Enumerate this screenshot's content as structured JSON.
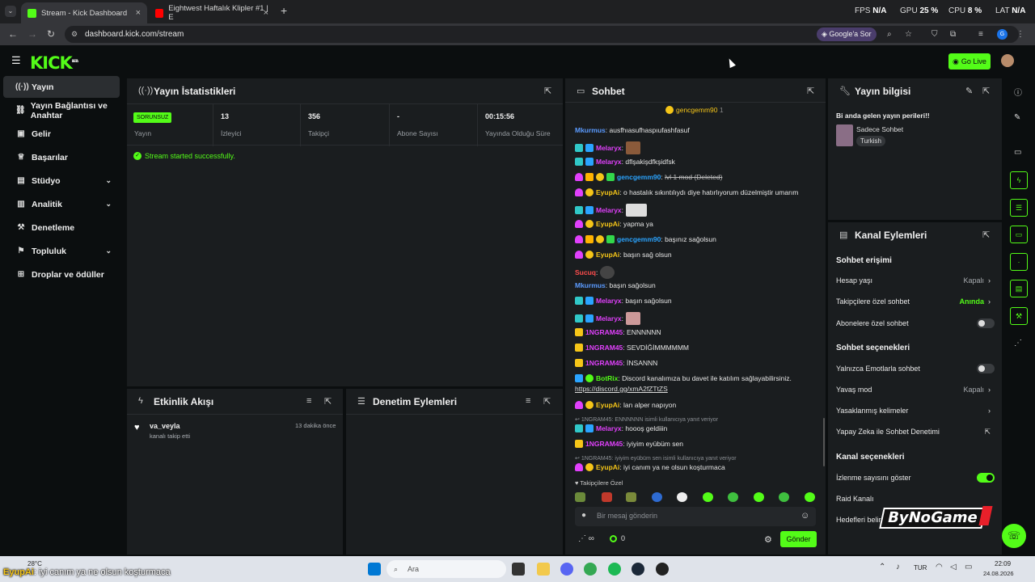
{
  "browser": {
    "tabs": [
      {
        "label": "Stream - Kick Dashboard",
        "active": true
      },
      {
        "label": "Eightwest Haftalık Klipler #1 | E",
        "active": false
      }
    ],
    "url": "dashboard.kick.com/stream",
    "google_sor": "Google'a Sor",
    "perf": {
      "fps_label": "FPS",
      "fps": "N/A",
      "gpu_label": "GPU",
      "gpu": "25 %",
      "cpu_label": "CPU",
      "cpu": "8 %",
      "lat_label": "LAT",
      "lat": "N/A"
    },
    "profile_initial": "G"
  },
  "header": {
    "logo": "KICK",
    "logo_beta": "BETA",
    "go_live": "Go Live"
  },
  "sidebar": {
    "items": [
      {
        "label": "Yayın",
        "icon": "broadcast-icon",
        "active": true,
        "chevron": false
      },
      {
        "label": "Yayın Bağlantısı ve Anahtar",
        "icon": "link-icon",
        "active": false,
        "chevron": false
      },
      {
        "label": "Gelir",
        "icon": "money-icon",
        "active": false,
        "chevron": false
      },
      {
        "label": "Başarılar",
        "icon": "trophy-icon",
        "active": false,
        "chevron": false
      },
      {
        "label": "Stüdyo",
        "icon": "studio-icon",
        "active": false,
        "chevron": true
      },
      {
        "label": "Analitik",
        "icon": "chart-icon",
        "active": false,
        "chevron": true
      },
      {
        "label": "Denetleme",
        "icon": "hammer-icon",
        "active": false,
        "chevron": false
      },
      {
        "label": "Topluluk",
        "icon": "community-icon",
        "active": false,
        "chevron": true
      },
      {
        "label": "Droplar ve ödüller",
        "icon": "gift-icon",
        "active": false,
        "chevron": false
      }
    ]
  },
  "stats_panel": {
    "title": "Yayın İstatistikleri",
    "status_badge": "SORUNSUZ",
    "stats": [
      {
        "value": "",
        "label": "Yayın"
      },
      {
        "value": "13",
        "label": "İzleyici"
      },
      {
        "value": "356",
        "label": "Takipçi"
      },
      {
        "value": "-",
        "label": "Abone Sayısı"
      },
      {
        "value": "00:15:56",
        "label": "Yayında Olduğu Süre"
      }
    ],
    "success_msg": "Stream started successfully."
  },
  "activity_panel": {
    "title": "Etkinlik Akışı",
    "events": [
      {
        "user": "va_veyla",
        "desc": "kanalı takip etti",
        "time": "13 dakika önce"
      }
    ]
  },
  "mod_panel": {
    "title": "Denetim Eylemleri"
  },
  "chat": {
    "title": "Sohbet",
    "pinned_user": "gencgemm90",
    "pinned_count": "1",
    "messages": [
      {
        "user": "Mkurmus",
        "color": "#5b9bff",
        "badges": [],
        "text": "ausfhıasufhaspıufashfasuf",
        "emote": false
      },
      {
        "user": "Melaryx",
        "color": "#e040fb",
        "badges": [
          "t",
          "b"
        ],
        "text": "",
        "emote": true
      },
      {
        "user": "Melaryx",
        "color": "#e040fb",
        "badges": [
          "t",
          "b"
        ],
        "text": "dflşakişdfkşidfsk",
        "emote": false
      },
      {
        "user": "gencgemm90",
        "color": "#2aa4ff",
        "badges": [
          "p",
          "o",
          "y",
          "gr"
        ],
        "text": "lvl 1 mod (Deleted)",
        "emote": false
      },
      {
        "user": "EyupAi",
        "color": "#f5c518",
        "badges": [
          "p",
          "y"
        ],
        "text": "o hastalık sıkıntılıydı diye hatırlıyorum düzelmiştir umarım",
        "emote": false
      },
      {
        "user": "Melaryx",
        "color": "#e040fb",
        "badges": [
          "t",
          "b"
        ],
        "text": "",
        "emote": true
      },
      {
        "user": "EyupAi",
        "color": "#f5c518",
        "badges": [
          "p",
          "y"
        ],
        "text": "yapma ya",
        "emote": false
      },
      {
        "user": "gencgemm90",
        "color": "#2aa4ff",
        "badges": [
          "p",
          "o",
          "y",
          "gr"
        ],
        "text": "başınız sağolsun",
        "emote": false
      },
      {
        "user": "EyupAi",
        "color": "#f5c518",
        "badges": [
          "p",
          "y"
        ],
        "text": "başın sağ olsun",
        "emote": false
      },
      {
        "user": "Sucuq",
        "color": "#ff4d4d",
        "badges": [],
        "text": "",
        "emote": true
      },
      {
        "user": "Mkurmus",
        "color": "#5b9bff",
        "badges": [],
        "text": "başın sağolsun",
        "emote": false
      },
      {
        "user": "Melaryx",
        "color": "#e040fb",
        "badges": [
          "t",
          "b"
        ],
        "text": "başın sağolsun",
        "emote": false
      },
      {
        "user": "Melaryx",
        "color": "#e040fb",
        "badges": [
          "t",
          "b"
        ],
        "text": "",
        "emote": true
      },
      {
        "user": "1NGRAM45",
        "color": "#e040fb",
        "badges": [
          "y"
        ],
        "text": "ENNNNNN",
        "emote": false
      },
      {
        "user": "1NGRAM45",
        "color": "#e040fb",
        "badges": [
          "y"
        ],
        "text": "SEVDİĞİMMMMMM",
        "emote": false
      },
      {
        "user": "1NGRAM45",
        "color": "#e040fb",
        "badges": [
          "y"
        ],
        "text": "İNSANNN",
        "emote": false
      },
      {
        "user": "BotRix",
        "color": "#53fc18",
        "badges": [
          "b",
          "g"
        ],
        "text": "Discord kanalımıza bu davet ile katılım sağlayabilirsiniz.",
        "emote": false
      },
      {
        "user": "EyupAi",
        "color": "#f5c518",
        "badges": [
          "p",
          "y"
        ],
        "text": "lan alper napıyon",
        "emote": false
      },
      {
        "user": "Melaryx",
        "color": "#e040fb",
        "badges": [
          "t",
          "b"
        ],
        "text": "hoooş geldiiin",
        "emote": false
      },
      {
        "user": "1NGRAM45",
        "color": "#e040fb",
        "badges": [
          "y"
        ],
        "text": "iyiyim eyübüm sen",
        "emote": false
      },
      {
        "user": "EyupAi",
        "color": "#f5c518",
        "badges": [
          "p",
          "y"
        ],
        "text": "iyi canım ya ne olsun koşturmaca",
        "emote": false
      }
    ],
    "discord_link": "https://discord.gg/xmA2fZTtZS",
    "replies": [
      "1NGRAM45: ENNNNNN isimli kullanıcıya yanıt veriyor",
      "1NGRAM45: iyiyim eyübüm sen isimli kullanıcıya yanıt veriyor"
    ],
    "followers_only": "Takipçilere Özel",
    "input_placeholder": "Bir mesaj gönderin",
    "viewer_count": "∞",
    "points": "0",
    "send": "Gönder"
  },
  "stream_info": {
    "title": "Yayın bilgisi",
    "stream_title": "Bi anda gelen yayın perileri!!",
    "category": "Sadece Sohbet",
    "tag": "Turkish"
  },
  "channel_actions": {
    "title": "Kanal Eylemleri",
    "sections": [
      {
        "heading": "Sohbet erişimi",
        "rows": [
          {
            "label": "Hesap yaşı",
            "value": "Kapalı",
            "type": "arrow"
          },
          {
            "label": "Takipçilere özel sohbet",
            "value": "Anında",
            "type": "arrow",
            "green": true
          },
          {
            "label": "Abonelere özel sohbet",
            "value": "",
            "type": "toggle",
            "on": false
          }
        ]
      },
      {
        "heading": "Sohbet seçenekleri",
        "rows": [
          {
            "label": "Yalnızca Emotlarla sohbet",
            "value": "",
            "type": "toggle",
            "on": false
          },
          {
            "label": "Yavaş mod",
            "value": "Kapalı",
            "type": "arrow"
          },
          {
            "label": "Yasaklanmış kelimeler",
            "value": "",
            "type": "arrow"
          },
          {
            "label": "Yapay Zeka ile Sohbet Denetimi",
            "value": "",
            "type": "external"
          }
        ]
      },
      {
        "heading": "Kanal seçenekleri",
        "rows": [
          {
            "label": "İzlenme sayısını göster",
            "value": "",
            "type": "toggle",
            "on": true
          },
          {
            "label": "Raid Kanalı",
            "value": "",
            "type": "none"
          },
          {
            "label": "Hedefleri belirle",
            "value": "",
            "type": "none"
          }
        ]
      }
    ]
  },
  "watermark": "ByNoGame",
  "taskbar": {
    "weather": "28°C",
    "search": "Ara",
    "lang": "TUR",
    "time": "22:09",
    "date": "24.08.2026"
  },
  "overlay_caption": {
    "user": "EyupAi",
    "text": "iyi canım ya ne olsun koşturmaca"
  }
}
